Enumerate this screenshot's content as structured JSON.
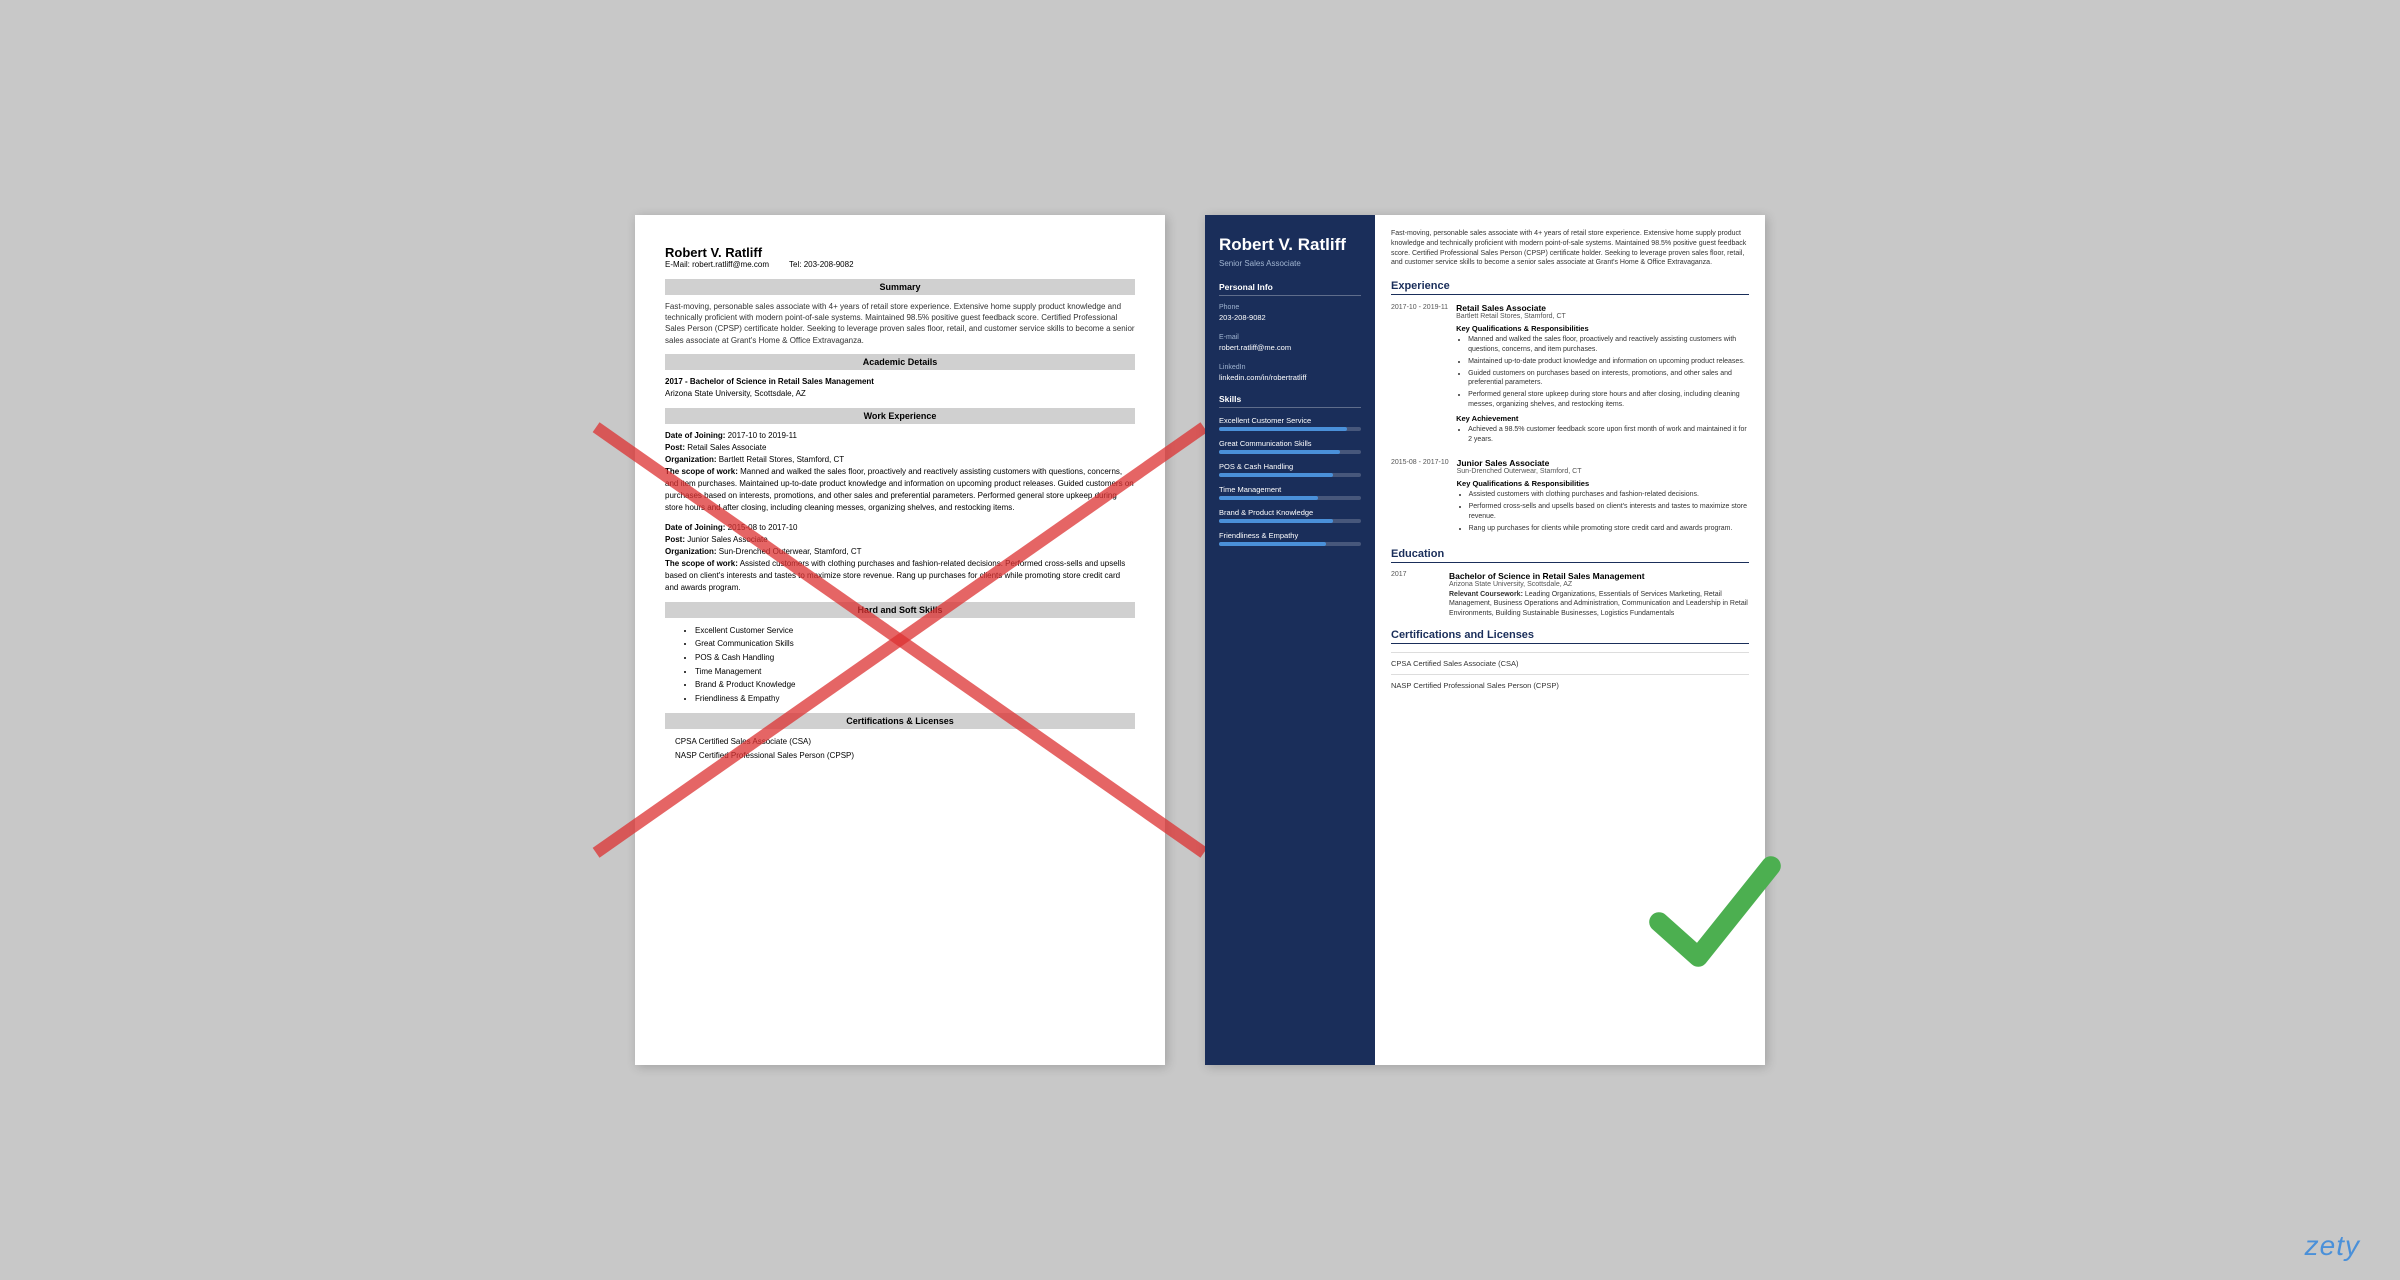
{
  "left_resume": {
    "name": "Robert V. Ratliff",
    "email_label": "E-Mail:",
    "email": "robert.ratliff@me.com",
    "tel_label": "Tel:",
    "tel": "203-208-9082",
    "sections": {
      "summary_title": "Summary",
      "summary_text": "Fast-moving, personable sales associate with 4+ years of retail store experience. Extensive home supply product knowledge and technically proficient with modern point-of-sale systems. Maintained 98.5% positive guest feedback score. Certified Professional Sales Person (CPSP) certificate holder. Seeking to leverage proven sales floor, retail, and customer service skills to become a senior sales associate at Grant's Home & Office Extravaganza.",
      "academic_title": "Academic Details",
      "degree": "2017 - Bachelor of Science in Retail Sales Management",
      "school": "Arizona State University, Scottsdale, AZ",
      "work_title": "Work Experience",
      "jobs": [
        {
          "date_of_joining": "2017-10 to 2019-11",
          "post": "Retail Sales Associate",
          "organization": "Bartlett Retail Stores, Stamford, CT",
          "scope_label": "The scope of work:",
          "scope": "Manned and walked the sales floor, proactively and reactively assisting customers with questions, concerns, and item purchases. Maintained up-to-date product knowledge and information on upcoming product releases. Guided customers on purchases based on interests, promotions, and other sales and preferential parameters. Performed general store upkeep during store hours and after closing, including cleaning messes, organizing shelves, and restocking items."
        },
        {
          "date_of_joining": "2015-08 to 2017-10",
          "post": "Junior Sales Associate",
          "organization": "Sun-Drenched Outerwear, Stamford, CT",
          "scope_label": "The scope of work:",
          "scope": "Assisted customers with clothing purchases and fashion-related decisions. Performed cross-sells and upsells based on client's interests and tastes to maximize store revenue. Rang up purchases for clients while promoting store credit card and awards program."
        }
      ],
      "skills_title": "Hard and Soft Skills",
      "skills": [
        "Excellent Customer Service",
        "Great Communication Skills",
        "POS & Cash Handling",
        "Time Management",
        "Brand & Product Knowledge",
        "Friendliness & Empathy"
      ],
      "certs_title": "Certifications & Licenses",
      "certs": [
        "CPSA Certified Sales Associate (CSA)",
        "NASP Certified Professional Sales Person (CPSP)"
      ]
    }
  },
  "right_resume": {
    "name": "Robert V. Ratliff",
    "title": "Senior Sales Associate",
    "sidebar": {
      "personal_info_title": "Personal Info",
      "phone_label": "Phone",
      "phone": "203-208-9082",
      "email_label": "E-mail",
      "email": "robert.ratliff@me.com",
      "linkedin_label": "LinkedIn",
      "linkedin": "linkedin.com/in/robertratliff",
      "skills_title": "Skills",
      "skills": [
        {
          "name": "Excellent Customer Service",
          "pct": 90
        },
        {
          "name": "Great Communication Skills",
          "pct": 85
        },
        {
          "name": "POS & Cash Handling",
          "pct": 80
        },
        {
          "name": "Time Management",
          "pct": 70
        },
        {
          "name": "Brand & Product Knowledge",
          "pct": 80
        },
        {
          "name": "Friendliness & Empathy",
          "pct": 75
        }
      ]
    },
    "summary": "Fast-moving, personable sales associate with 4+ years of retail store experience. Extensive home supply product knowledge and technically proficient with modern point-of-sale systems. Maintained 98.5% positive guest feedback score. Certified Professional Sales Person (CPSP) certificate holder. Seeking to leverage proven sales floor, retail, and customer service skills to become a senior sales associate at Grant's Home & Office Extravaganza.",
    "experience_title": "Experience",
    "jobs": [
      {
        "dates": "2017-10 - 2019-11",
        "title": "Retail Sales Associate",
        "company": "Bartlett Retail Stores, Stamford, CT",
        "kq_title": "Key Qualifications & Responsibilities",
        "bullets": [
          "Manned and walked the sales floor, proactively and reactively assisting customers with questions, concerns, and item purchases.",
          "Maintained up-to-date product knowledge and information on upcoming product releases.",
          "Guided customers on purchases based on interests, promotions, and other sales and preferential parameters.",
          "Performed general store upkeep during store hours and after closing, including cleaning messes, organizing shelves, and restocking items."
        ],
        "achievement_title": "Key Achievement",
        "achievement": "Achieved a 98.5% customer feedback score upon first month of work and maintained it for 2 years."
      },
      {
        "dates": "2015-08 - 2017-10",
        "title": "Junior Sales Associate",
        "company": "Sun-Drenched Outerwear, Stamford, CT",
        "kq_title": "Key Qualifications & Responsibilities",
        "bullets": [
          "Assisted customers with clothing purchases and fashion-related decisions.",
          "Performed cross-sells and upsells based on client's interests and tastes to maximize store revenue.",
          "Rang up purchases for clients while promoting store credit card and awards program."
        ]
      }
    ],
    "education_title": "Education",
    "education": [
      {
        "year": "2017",
        "degree": "Bachelor of Science in Retail Sales Management",
        "school": "Arizona State University, Scottsdale, AZ",
        "coursework_label": "Relevant Coursework:",
        "coursework": "Leading Organizations, Essentials of Services Marketing, Retail Management, Business Operations and Administration, Communication and Leadership in Retail Environments, Building Sustainable Businesses, Logistics Fundamentals"
      }
    ],
    "certs_title": "Certifications and Licenses",
    "certs": [
      "CPSA Certified Sales Associate (CSA)",
      "NASP Certified Professional Sales Person (CPSP)"
    ]
  },
  "watermark": "zety"
}
